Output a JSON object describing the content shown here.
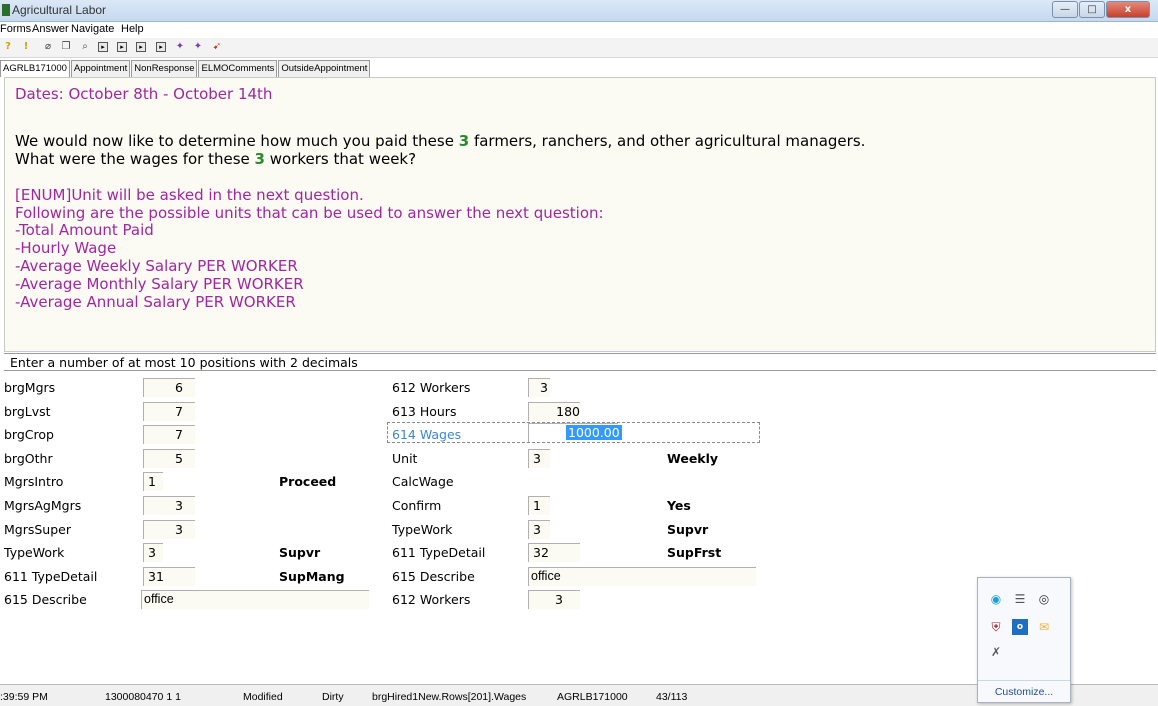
{
  "window": {
    "title": "Agricultural Labor",
    "minimize": "—",
    "maximize": "□",
    "close": "x"
  },
  "menu": {
    "items": [
      "Forms",
      "Answer",
      "Navigate",
      "Help"
    ]
  },
  "toolbar": {
    "icons": [
      "help-icon",
      "info-icon",
      "clip-icon",
      "copy-icon",
      "find-icon",
      "nav1-icon",
      "nav2-icon",
      "nav3-icon",
      "nav4-icon",
      "tool1-icon",
      "tool2-icon",
      "tool3-icon"
    ]
  },
  "tabs": [
    "AGRLB171000",
    "Appointment",
    "NonResponse",
    "ELMOComments",
    "OutsideAppointment"
  ],
  "question": {
    "dates": "Dates: October 8th - October 14th",
    "line1_pre": "We would now like to determine how much you paid these ",
    "line1_num": "3",
    "line1_post": " farmers, ranchers, and other agricultural managers.",
    "line2_pre": "What were the wages for these ",
    "line2_num": "3",
    "line2_post": " workers that week?",
    "enum": "[ENUM]Unit will be asked in the next question.",
    "units_intro": "Following are the possible units that can be used to answer the next question:",
    "units": [
      "-Total Amount Paid",
      "-Hourly Wage",
      "-Average Weekly Salary PER WORKER",
      "-Average Monthly Salary PER WORKER",
      "-Average Annual Salary PER WORKER"
    ]
  },
  "hint": "Enter a number of at most 10 positions with 2 decimals",
  "left_fields": [
    {
      "label": "brgMgrs",
      "value": "6"
    },
    {
      "label": "brgLvst",
      "value": "7"
    },
    {
      "label": "brgCrop",
      "value": "7"
    },
    {
      "label": "brgOthr",
      "value": "5"
    },
    {
      "label": "MgrsIntro",
      "value": "1",
      "answer": "Proceed"
    },
    {
      "label": "MgrsAgMgrs",
      "value": "3"
    },
    {
      "label": "MgrsSuper",
      "value": "3"
    },
    {
      "label": "TypeWork",
      "value": "3",
      "answer": "Supvr"
    },
    {
      "label": "611 TypeDetail",
      "value": "31",
      "answer": "SupMang"
    },
    {
      "label": "615 Describe",
      "value": "office"
    }
  ],
  "right_fields": [
    {
      "label": "612 Workers",
      "value": "3"
    },
    {
      "label": "613 Hours",
      "value": "180"
    },
    {
      "label": "614 Wages",
      "value": "1000.00"
    },
    {
      "label": "Unit",
      "value": "3",
      "answer": "Weekly"
    },
    {
      "label": "CalcWage",
      "value": ""
    },
    {
      "label": "Confirm",
      "value": "1",
      "answer": "Yes"
    },
    {
      "label": "TypeWork",
      "value": "3",
      "answer": "Supvr"
    },
    {
      "label": "611 TypeDetail",
      "value": "32",
      "answer": "SupFrst"
    },
    {
      "label": "615 Describe",
      "value": "office"
    },
    {
      "label": "612 Workers",
      "value": "3"
    }
  ],
  "status": {
    "time": ":39:59 PM",
    "case_id": "1300080470 1 1",
    "modified": "Modified",
    "dirty": "Dirty",
    "field_path": "brgHired1New.Rows[201].Wages",
    "instrument": "AGRLB171000",
    "page": "43/113"
  },
  "tray": {
    "customize": "Customize..."
  }
}
